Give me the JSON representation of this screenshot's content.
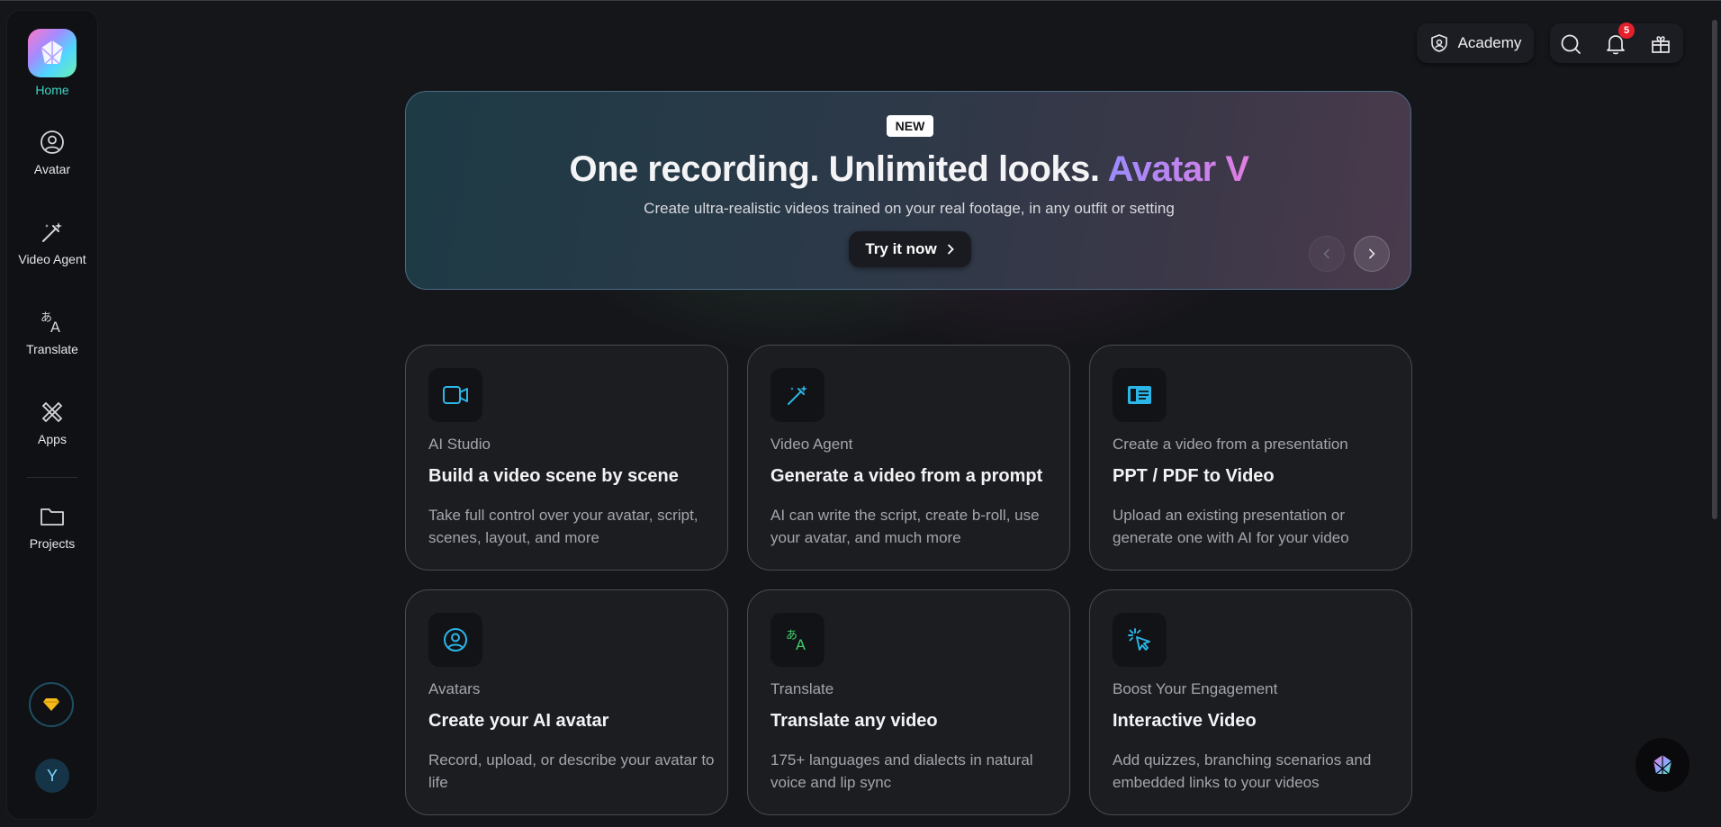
{
  "sidebar": {
    "home_label": "Home",
    "items": [
      {
        "label": "Avatar",
        "icon": "avatar-icon"
      },
      {
        "label": "Video Agent",
        "icon": "magic-wand-icon"
      },
      {
        "label": "Translate",
        "icon": "translate-icon"
      },
      {
        "label": "Apps",
        "icon": "apps-icon"
      },
      {
        "label": "Projects",
        "icon": "folder-icon"
      }
    ],
    "user_initial": "Y"
  },
  "topbar": {
    "academy_label": "Academy",
    "notification_count": "5"
  },
  "banner": {
    "badge": "NEW",
    "headline": "One recording. Unlimited looks.",
    "headline_accent": "Avatar V",
    "subline": "Create ultra-realistic videos trained on your real footage, in any outfit or setting",
    "cta": "Try it now"
  },
  "cards": [
    {
      "kicker": "AI Studio",
      "title": "Build a video scene by scene",
      "desc": "Take full control over your avatar, script, scenes, layout, and more"
    },
    {
      "kicker": "Video Agent",
      "title": "Generate a video from a prompt",
      "desc": "AI can write the script, create b-roll, use your avatar, and much more"
    },
    {
      "kicker": "Create a video from a presentation",
      "title": "PPT / PDF to Video",
      "desc": "Upload an existing presentation or generate one with AI for your video"
    },
    {
      "kicker": "Avatars",
      "title": "Create your AI avatar",
      "desc": "Record, upload, or describe your avatar to life"
    },
    {
      "kicker": "Translate",
      "title": "Translate any video",
      "desc": "175+ languages and dialects in natural voice and lip sync"
    },
    {
      "kicker": "Boost Your Engagement",
      "title": "Interactive Video",
      "desc": "Add quizzes, branching scenarios and embedded links to your videos"
    }
  ],
  "colors": {
    "accent": "#3fd3c7",
    "card_icon": "#2bb6e8",
    "translate_icon": "#3fcf6a",
    "badge": "#e5202b"
  }
}
